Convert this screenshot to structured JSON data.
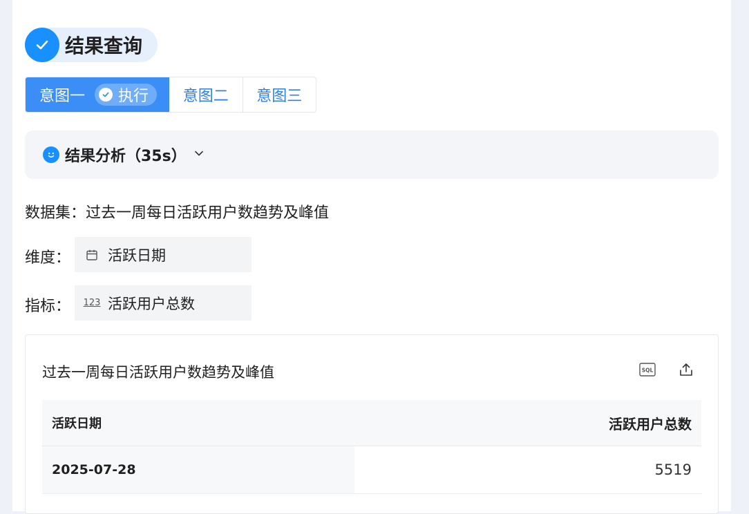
{
  "header": {
    "title": "结果查询"
  },
  "tabs": [
    {
      "label": "意图一",
      "badge": "执行"
    },
    {
      "label": "意图二"
    },
    {
      "label": "意图三"
    }
  ],
  "analysis": {
    "title": "结果分析（35s）"
  },
  "dataset": {
    "text": "数据集：过去一周每日活跃用户数趋势及峰值"
  },
  "dimension": {
    "label": "维度：",
    "value": "活跃日期",
    "icon": "calendar-icon"
  },
  "metric": {
    "label": "指标：",
    "value": "活跃用户总数",
    "icon": "number-icon",
    "icon_text": "123"
  },
  "card": {
    "title": "过去一周每日活跃用户数趋势及峰值",
    "tools": [
      "sql-icon",
      "export-icon"
    ],
    "sql_icon_text": "SQL"
  },
  "table": {
    "columns": [
      "活跃日期",
      "活跃用户总数"
    ],
    "rows": [
      {
        "date": "2025-07-28",
        "count": "5519"
      }
    ]
  },
  "colors": {
    "accent": "#1890ff",
    "tab_active": "#3a8ef6",
    "panel_bg": "#f3f5f9"
  }
}
